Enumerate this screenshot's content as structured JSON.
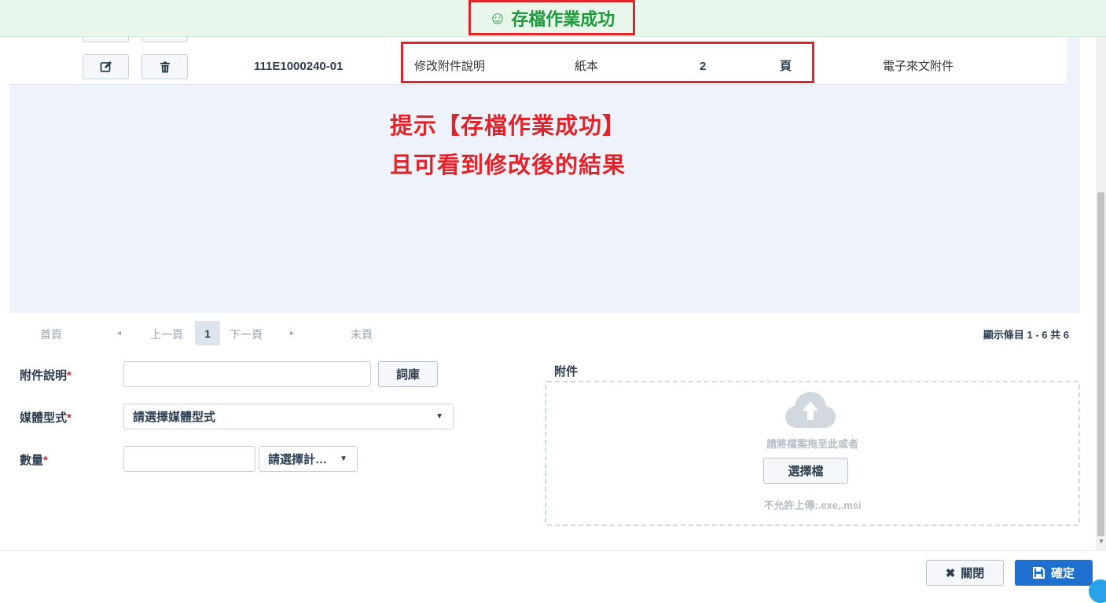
{
  "banner": {
    "icon": "☺",
    "text": "存檔作業成功"
  },
  "row": {
    "edit_icon": "edit-icon",
    "delete_icon": "trash-icon",
    "doc_no": "111E1000240-01",
    "description": "修改附件說明",
    "media": "紙本",
    "quantity": "2",
    "unit": "頁",
    "category": "電子來文附件"
  },
  "annotation": {
    "line1": "提示【存檔作業成功】",
    "line2": "且可看到修改後的結果"
  },
  "pager": {
    "first": "首頁",
    "prev_arrow": "◂",
    "prev": "上一頁",
    "current": "1",
    "next": "下一頁",
    "next_arrow": "▸",
    "last": "末頁",
    "info": "顯示條目 1 - 6 共 6"
  },
  "form": {
    "desc_label": "附件說明",
    "desc_value": "",
    "thesaurus_button": "詞庫",
    "media_label": "媒體型式",
    "media_select": "請選擇媒體型式",
    "qty_label": "數量",
    "qty_value": "",
    "unit_select": "請選擇計…",
    "required_mark": "*"
  },
  "attachment": {
    "label": "附件",
    "drop_text": "請將檔案拖至此或者",
    "choose_button": "選擇檔",
    "restriction": "不允許上傳:.exe,.msi"
  },
  "footer": {
    "close_icon": "✖",
    "close_label": "關閉",
    "confirm_label": "確定"
  },
  "colors": {
    "success_green": "#1f9a3a",
    "highlight_red": "#e0242b",
    "primary_blue": "#1f6fd1"
  }
}
